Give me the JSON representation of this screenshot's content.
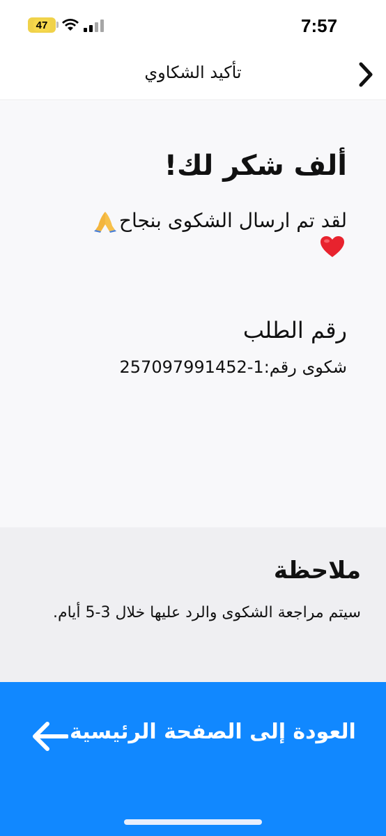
{
  "status_bar": {
    "time": "7:57",
    "battery": "47",
    "battery_color": "#f7d84c"
  },
  "nav": {
    "title": "تأكيد الشكاوي",
    "back_icon": "chevron-right-icon"
  },
  "confirmation": {
    "title": "ألف شكر لك!",
    "message": "لقد تم ارسال الشكوى بنجاح",
    "emoji_pray": "folded-hands-icon",
    "emoji_heart": "red-heart-icon"
  },
  "order": {
    "label": "رقم الطلب",
    "number_text": "شكوى رقم:1-257097991452"
  },
  "note": {
    "title": "ملاحظة",
    "text": "سيتم مراجعة الشكوى والرد عليها خلال 3-5 أيام."
  },
  "home_button": {
    "label": "العودة إلى الصفحة الرئيسية",
    "icon": "arrow-left-icon",
    "color": "#1188ff"
  },
  "colors": {
    "main_bg": "#f8f8fa",
    "note_bg": "#efeff2",
    "accent": "#1188ff"
  }
}
